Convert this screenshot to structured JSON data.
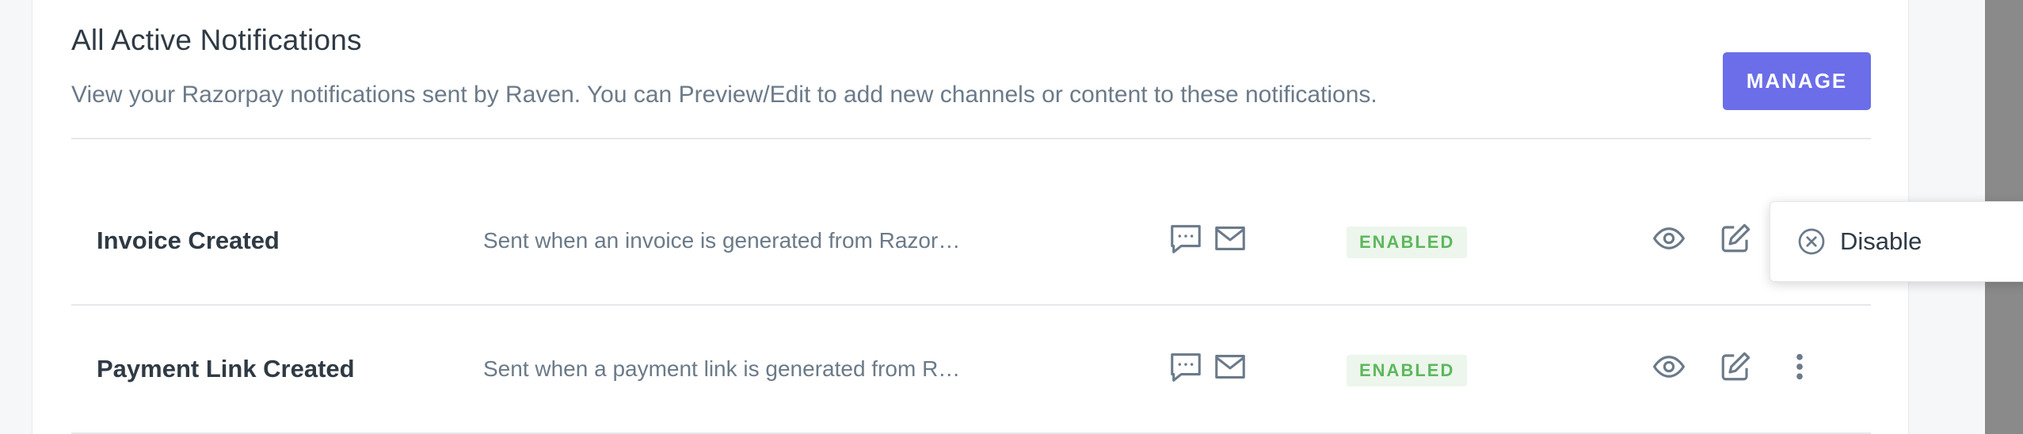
{
  "header": {
    "title": "All Active Notifications",
    "subtitle": "View your Razorpay notifications sent by Raven. You can Preview/Edit to add new channels or content to these notifications.",
    "manage_label": "MANAGE"
  },
  "notifications": [
    {
      "name": "Invoice Created",
      "description": "Sent when an invoice is generated from Razor…",
      "channels": [
        "sms-icon",
        "mail-icon"
      ],
      "status": "ENABLED"
    },
    {
      "name": "Payment Link Created",
      "description": "Sent when a payment link is generated from R…",
      "channels": [
        "sms-icon",
        "mail-icon"
      ],
      "status": "ENABLED"
    }
  ],
  "menu": {
    "disable_label": "Disable"
  },
  "colors": {
    "accent": "#6b6ee8",
    "status_enabled_text": "#5cb85c",
    "status_enabled_bg": "#edf6ec",
    "icon_gray": "#6b7a89"
  }
}
